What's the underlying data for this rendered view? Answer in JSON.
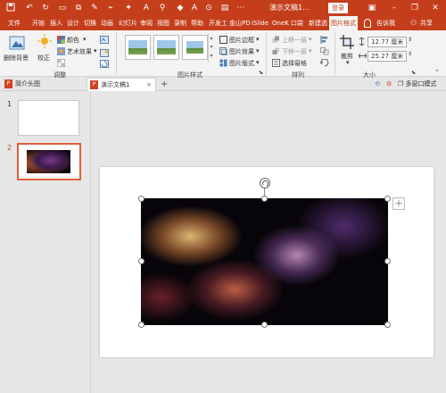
{
  "title_bar": {
    "doc_title": "演示文稿1...",
    "login_label": "登录",
    "icons": [
      "save-icon",
      "undo-icon",
      "redo-icon",
      "brush-icon",
      "minimize-icon",
      "restore-icon",
      "close-icon"
    ]
  },
  "menu": {
    "tabs": [
      "文件",
      "开始",
      "插入",
      "设计",
      "切换",
      "动画",
      "幻灯片",
      "审阅",
      "视图",
      "录制",
      "帮助",
      "开发工",
      "金山PD",
      "iSlide",
      "OneK",
      "口袋",
      "新建选",
      "图片格式"
    ],
    "active_tab": "图片格式",
    "tell_me": "告诉我",
    "share": "共享"
  },
  "ribbon": {
    "adjust": {
      "remove_bg": "删除背景",
      "corrections": "校正",
      "color": "颜色",
      "artistic": "艺术效果",
      "group_label": "调整"
    },
    "picture_styles": {
      "border": "图片边框",
      "effects": "图片效果",
      "layout": "图片版式",
      "group_label": "图片样式"
    },
    "arrange": {
      "bring_forward": "上移一层",
      "send_backward": "下移一层",
      "selection_pane": "选择窗格",
      "group_label": "排列"
    },
    "size": {
      "crop": "裁剪",
      "height": "12.77 厘米",
      "width": "25.27 厘米",
      "group_label": "大小"
    }
  },
  "doc_tabs": {
    "tab1": "简介头图",
    "tab2": "演示文稿1",
    "multi_window": "多窗口模式"
  },
  "slides": {
    "num1": "1",
    "num2": "2"
  },
  "colors": {
    "accent": "#c43e1c",
    "selected_thumb_border": "#e25f3c"
  }
}
